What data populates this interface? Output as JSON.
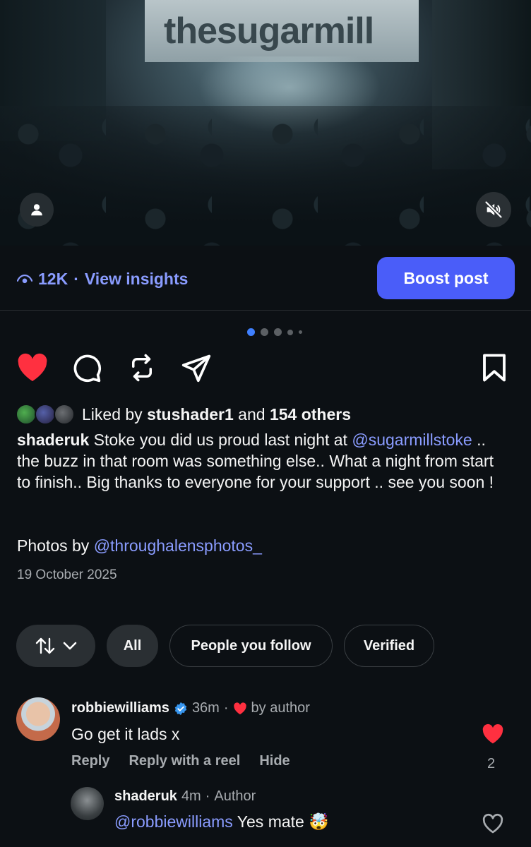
{
  "post": {
    "photo_banner_text": "thesugarmill",
    "views": "12K",
    "view_insights": "View insights",
    "boost": "Boost post",
    "carousel": {
      "count": 5,
      "active": 1
    },
    "liked_by_prefix": "Liked by",
    "liked_by_user": "stushader1",
    "liked_by_and": "and",
    "liked_by_others": "154 others",
    "caption_user": "shaderuk",
    "caption_part1": "Stoke you did us proud last night at",
    "caption_mention": "@sugarmillstoke",
    "caption_part2": ".. the buzz in that room was something else.. What a night from start to finish.. Big thanks to everyone for your support .. see you soon !",
    "photos_by": "Photos by",
    "photos_mention": "@throughalensphotos_",
    "date": "19 October 2025"
  },
  "filters": {
    "all": "All",
    "people_you_follow": "People you follow",
    "verified": "Verified"
  },
  "comments": [
    {
      "user": "robbiewilliams",
      "verified": true,
      "time": "36m",
      "liked_by_author": "by author",
      "text": "Go get it lads x",
      "reply": "Reply",
      "reply_reel": "Reply with a reel",
      "hide": "Hide",
      "likes": "2"
    },
    {
      "user": "shaderuk",
      "time": "4m",
      "badge": "Author",
      "mention": "@robbiewilliams",
      "text": "Yes mate 🤯"
    }
  ],
  "colors": {
    "accent": "#4a5df9",
    "link": "#8a9cff",
    "like": "#ff3040",
    "background": "#0c1014"
  },
  "icons": [
    "person-icon",
    "muted-speaker-icon",
    "eye-icon",
    "heart-icon",
    "comment-icon",
    "repost-icon",
    "share-icon",
    "bookmark-icon",
    "sort-icon",
    "chevron-down-icon",
    "verified-icon"
  ]
}
